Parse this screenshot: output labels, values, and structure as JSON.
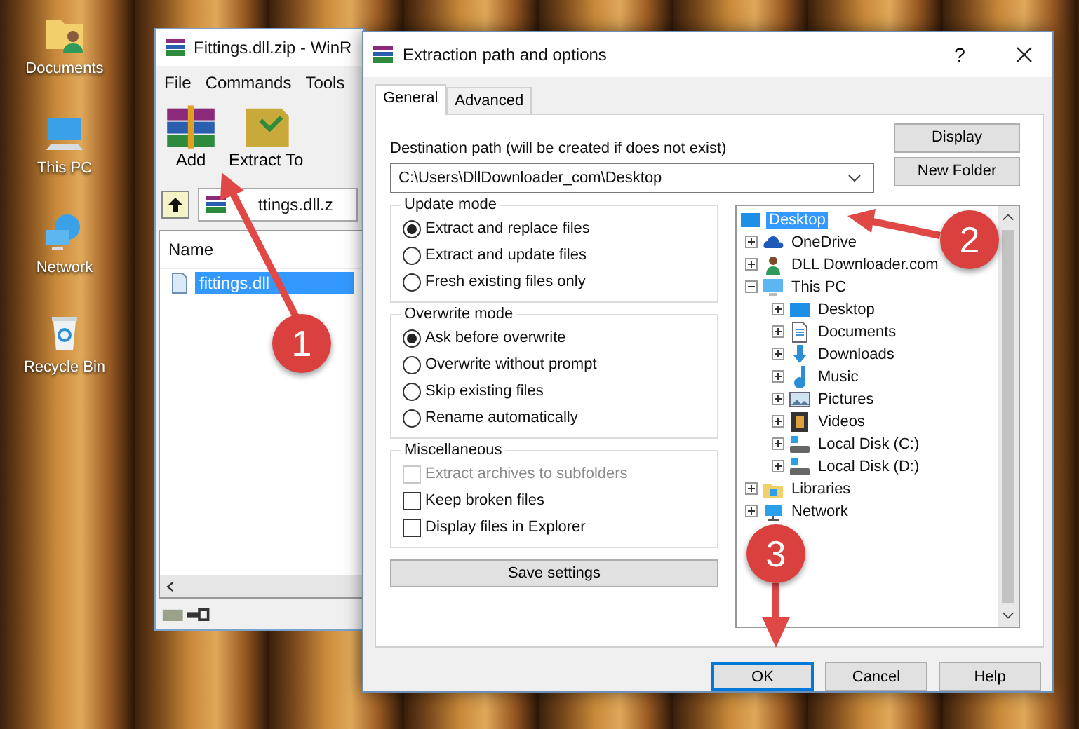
{
  "desktop": {
    "icons": [
      {
        "label": "Documents",
        "kind": "documents"
      },
      {
        "label": "This PC",
        "kind": "pc"
      },
      {
        "label": "Network",
        "kind": "network"
      },
      {
        "label": "Recycle Bin",
        "kind": "recycle"
      }
    ]
  },
  "archive_window": {
    "title": "Fittings.dll.zip - WinR",
    "menu": [
      "File",
      "Commands",
      "Tools"
    ],
    "toolbar": [
      {
        "label": "Add",
        "kind": "add"
      },
      {
        "label": "Extract To",
        "kind": "extract"
      }
    ],
    "path": "ttings.dll.z",
    "columns": [
      "Name"
    ],
    "files": [
      {
        "name": "fittings.dll",
        "selected": true
      }
    ]
  },
  "dialog": {
    "title": "Extraction path and options",
    "help": "?",
    "tabs": [
      {
        "label": "General",
        "selected": true
      },
      {
        "label": "Advanced",
        "selected": false
      }
    ],
    "destination_label": "Destination path (will be created if does not exist)",
    "destination_path": "C:\\Users\\DllDownloader_com\\Desktop",
    "side_buttons": [
      "Display",
      "New Folder"
    ],
    "groups": [
      {
        "title": "Update mode",
        "options": [
          {
            "kind": "radio",
            "label": "Extract and replace files",
            "selected": true
          },
          {
            "kind": "radio",
            "label": "Extract and update files",
            "selected": false
          },
          {
            "kind": "radio",
            "label": "Fresh existing files only",
            "selected": false
          }
        ]
      },
      {
        "title": "Overwrite mode",
        "options": [
          {
            "kind": "radio",
            "label": "Ask before overwrite",
            "selected": true
          },
          {
            "kind": "radio",
            "label": "Overwrite without prompt",
            "selected": false
          },
          {
            "kind": "radio",
            "label": "Skip existing files",
            "selected": false
          },
          {
            "kind": "radio",
            "label": "Rename automatically",
            "selected": false
          }
        ]
      },
      {
        "title": "Miscellaneous",
        "options": [
          {
            "kind": "checkbox",
            "label": "Extract archives to subfolders",
            "checked": false,
            "disabled": true
          },
          {
            "kind": "checkbox",
            "label": "Keep broken files",
            "checked": false,
            "disabled": false
          },
          {
            "kind": "checkbox",
            "label": "Display files in Explorer",
            "checked": false,
            "disabled": false
          }
        ]
      }
    ],
    "save_button": "Save settings",
    "tree": [
      {
        "label": "Desktop",
        "kind": "desktop",
        "selected": true,
        "children": [
          {
            "label": "OneDrive",
            "kind": "cloud",
            "selected": false,
            "expanded": false
          },
          {
            "label": "DLL Downloader.com",
            "kind": "user",
            "selected": false,
            "expanded": false
          },
          {
            "label": "This PC",
            "kind": "pc",
            "selected": false,
            "expanded": true,
            "children": [
              {
                "label": "Desktop",
                "kind": "desktop",
                "selected": false,
                "expanded": false
              },
              {
                "label": "Documents",
                "kind": "document",
                "selected": false,
                "expanded": false
              },
              {
                "label": "Downloads",
                "kind": "download",
                "selected": false,
                "expanded": false
              },
              {
                "label": "Music",
                "kind": "music",
                "selected": false,
                "expanded": false
              },
              {
                "label": "Pictures",
                "kind": "picture",
                "selected": false,
                "expanded": false
              },
              {
                "label": "Videos",
                "kind": "video",
                "selected": false,
                "expanded": false
              },
              {
                "label": "Local Disk (C:)",
                "kind": "disk",
                "selected": false,
                "expanded": false
              },
              {
                "label": "Local Disk (D:)",
                "kind": "disk",
                "selected": false,
                "expanded": false
              }
            ]
          },
          {
            "label": "Libraries",
            "kind": "folder",
            "selected": false,
            "expanded": false
          },
          {
            "label": "Network",
            "kind": "network",
            "selected": false,
            "expanded": false
          }
        ]
      }
    ],
    "buttons": [
      {
        "label": "OK",
        "default": true
      },
      {
        "label": "Cancel",
        "default": false
      },
      {
        "label": "Help",
        "default": false
      }
    ]
  },
  "annotations": [
    {
      "number": "1"
    },
    {
      "number": "2"
    },
    {
      "number": "3"
    }
  ]
}
